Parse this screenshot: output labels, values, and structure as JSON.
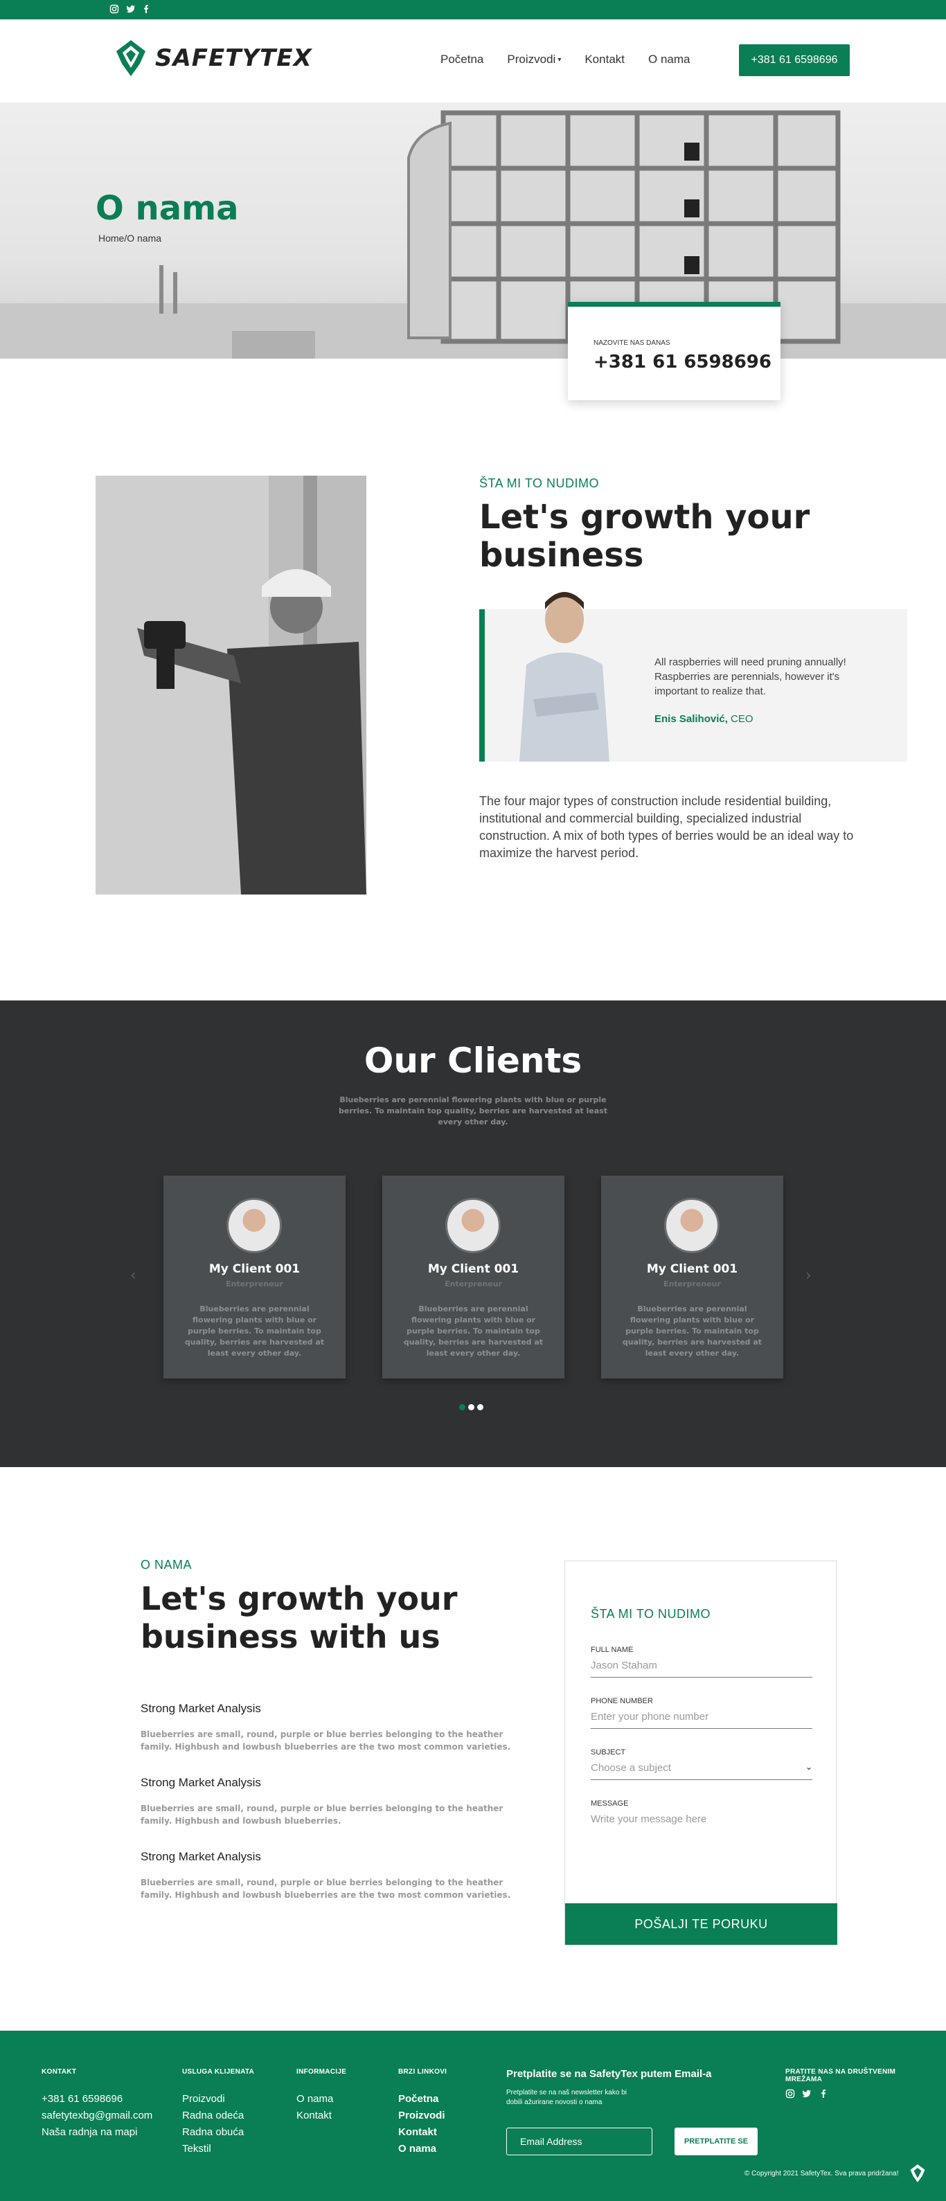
{
  "topbar": {
    "social": [
      "instagram-icon",
      "twitter-icon",
      "facebook-icon"
    ]
  },
  "header": {
    "logo_text": "SAFETYTEX",
    "nav": [
      "Početna",
      "Proizvodi",
      "Kontakt",
      "O nama"
    ],
    "call_button": "+381 61 6598696"
  },
  "hero": {
    "title": "O nama",
    "breadcrumb": "Home/O nama",
    "call_label": "NAZOVITE NAS DANAS",
    "call_number": "+381 61 6598696"
  },
  "about": {
    "eyebrow": "ŠTA MI TO NUDIMO",
    "title": "Let's growth your business",
    "quote": "All raspberries will need pruning annually! Raspberries are perennials, however it's important to realize that.",
    "author": "Enis Salihović,",
    "author_role": "CEO",
    "text": "The four major types of construction include residential building, institutional and commercial building, specialized industrial construction. A mix of both types of berries would be an ideal way to maximize the harvest period."
  },
  "clients": {
    "title": "Our Clients",
    "subtitle": "Blueberries are perennial flowering plants with blue or purple berries. To maintain top quality, berries are harvested at least every other day.",
    "cards": [
      {
        "name": "My Client 001",
        "role": "Enterpreneur",
        "desc": "Blueberries are perennial flowering plants with blue or purple berries. To maintain top quality, berries are harvested at least every other day."
      },
      {
        "name": "My Client 001",
        "role": "Enterpreneur",
        "desc": "Blueberries are perennial flowering plants with blue or purple berries. To maintain top quality, berries are harvested at least every other day."
      },
      {
        "name": "My Client 001",
        "role": "Enterpreneur",
        "desc": "Blueberries are perennial flowering plants with blue or purple berries. To maintain top quality, berries are harvested at least every other day."
      }
    ],
    "prev": "‹",
    "next": "›"
  },
  "contact": {
    "eyebrow": "O NAMA",
    "title": "Let's growth your business with us",
    "features": [
      {
        "title": "Strong Market Analysis",
        "text": "Blueberries are small, round, purple or blue berries belonging to the heather family. Highbush and lowbush blueberries are the two most common varieties."
      },
      {
        "title": "Strong Market Analysis",
        "text": "Blueberries are small, round, purple or blue berries belonging to the heather family. Highbush and lowbush blueberries."
      },
      {
        "title": "Strong Market Analysis",
        "text": "Blueberries are small, round, purple or blue berries belonging to the heather family. Highbush and lowbush blueberries are the two most common varieties."
      }
    ],
    "form": {
      "eyebrow": "ŠTA MI TO NUDIMO",
      "full_name_label": "FULL NAME",
      "full_name_placeholder": "Jason Staham",
      "phone_label": "PHONE NUMBER",
      "phone_placeholder": "Enter your phone number",
      "subject_label": "SUBJECT",
      "subject_placeholder": "Choose a subject",
      "message_label": "MESSAGE",
      "message_placeholder": "Write your message here",
      "submit": "POŠALJI TE PORUKU"
    }
  },
  "footer": {
    "kontakt": {
      "title": "KONTAKT",
      "items": [
        "+381 61 6598696",
        "safetytexbg@gmail.com",
        "Naša radnja na mapi"
      ]
    },
    "usluga": {
      "title": "USLUGA KLIJENATA",
      "items": [
        "Proizvodi",
        "Radna odeća",
        "Radna obuća",
        "Tekstil"
      ]
    },
    "informacije": {
      "title": "INFORMACIJE",
      "items": [
        "O nama",
        "Kontakt"
      ]
    },
    "brzi": {
      "title": "BRZI LINKOVI",
      "items": [
        "Početna",
        "Proizvodi",
        "Kontakt",
        "O nama"
      ]
    },
    "newsletter": {
      "title": "Pretplatite se na SafetyTex putem Email-a",
      "text": "Pretplatite se na naš newsletter kako bi dobili ažurirane novosti o nama",
      "input_placeholder": "Email Address",
      "button": "PRETPLATITE SE"
    },
    "social_title": "PRATITE NAS NA DRUŠTVENIM MREŽAMA",
    "copyright": "© Copyright 2021 SafetyTex. Sva prava pridržana!"
  },
  "colors": {
    "brand": "#0a7e55",
    "dark": "#2f3133",
    "card": "#4a4e50"
  }
}
